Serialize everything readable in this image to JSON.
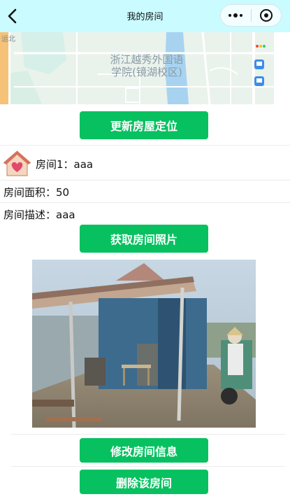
{
  "navbar": {
    "title": "我的房间",
    "back_icon": "chevron-left-icon",
    "more_icon": "more-dots-icon",
    "close_icon": "target-circle-icon",
    "background": "#c9fbff"
  },
  "map": {
    "place_label_line1": "浙江越秀外国语",
    "place_label_line2": "学院(镜湖校区)",
    "edge_text": "运北"
  },
  "buttons": {
    "update_location": "更新房屋定位",
    "get_photo": "获取房间照片",
    "edit_room": "修改房间信息",
    "delete_room": "删除该房间",
    "color": "#07c160"
  },
  "room": {
    "name": "房间1：aaa",
    "icon": "house-heart-icon",
    "area": "房间面积：50",
    "description": "房间描述：aaa"
  },
  "photo": {
    "subject": "room-photo"
  }
}
